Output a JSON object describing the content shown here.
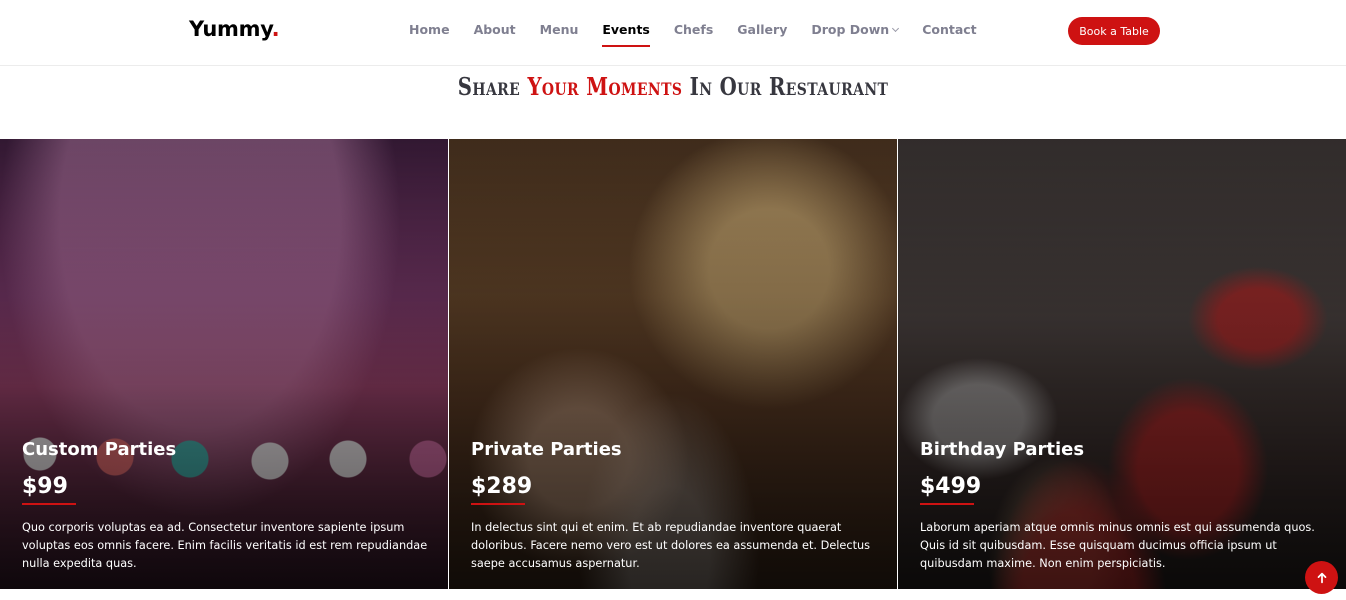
{
  "header": {
    "logo_text": "Yummy",
    "logo_dot": ".",
    "nav": [
      {
        "label": "Home",
        "active": false
      },
      {
        "label": "About",
        "active": false
      },
      {
        "label": "Menu",
        "active": false
      },
      {
        "label": "Events",
        "active": true
      },
      {
        "label": "Chefs",
        "active": false
      },
      {
        "label": "Gallery",
        "active": false
      },
      {
        "label": "Drop Down",
        "active": false,
        "dropdown": true
      },
      {
        "label": "Contact",
        "active": false
      }
    ],
    "book_button": "Book a Table"
  },
  "section": {
    "title_part1": "Share ",
    "title_accent": "Your Moments",
    "title_part2": " In Our Restaurant"
  },
  "events": [
    {
      "title": "Custom Parties",
      "price": "$99",
      "description": "Quo corporis voluptas ea ad. Consectetur inventore sapiente ipsum voluptas eos omnis facere. Enim facilis veritatis id est rem repudiandae nulla expedita quas."
    },
    {
      "title": "Private Parties",
      "price": "$289",
      "description": "In delectus sint qui et enim. Et ab repudiandae inventore quaerat doloribus. Facere nemo vero est ut dolores ea assumenda et. Delectus saepe accusamus aspernatur."
    },
    {
      "title": "Birthday Parties",
      "price": "$499",
      "description": "Laborum aperiam atque omnis minus omnis est qui assumenda quos. Quis id sit quibusdam. Esse quisquam ducimus officia ipsum ut quibusdam maxime. Non enim perspiciatis."
    }
  ],
  "colors": {
    "accent": "#ce1212",
    "nav_text": "#7f7f90",
    "title_text": "#37373f"
  },
  "icons": {
    "scroll_top": "arrow-up-icon",
    "dropdown": "chevron-down-icon"
  }
}
